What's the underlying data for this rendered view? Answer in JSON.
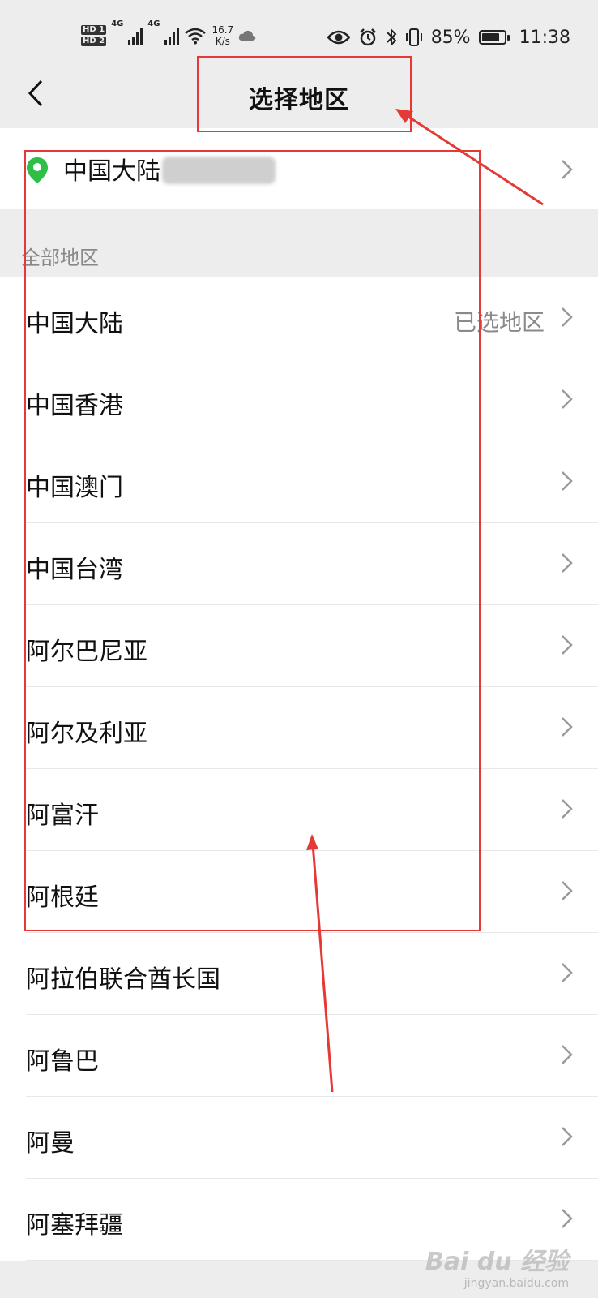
{
  "status_bar": {
    "hd1": "HD 1",
    "hd2": "HD 2",
    "net1": "4G",
    "net2": "4G",
    "speed_value": "16.7",
    "speed_unit": "K/s",
    "battery_percent": "85%",
    "battery_level": 0.85,
    "time": "11:38"
  },
  "nav": {
    "title": "选择地区"
  },
  "current_location": {
    "name": "中国大陆"
  },
  "section_header": "全部地区",
  "regions": [
    {
      "name": "中国大陆",
      "note": "已选地区"
    },
    {
      "name": "中国香港",
      "note": ""
    },
    {
      "name": "中国澳门",
      "note": ""
    },
    {
      "name": "中国台湾",
      "note": ""
    },
    {
      "name": "阿尔巴尼亚",
      "note": ""
    },
    {
      "name": "阿尔及利亚",
      "note": ""
    },
    {
      "name": "阿富汗",
      "note": ""
    },
    {
      "name": "阿根廷",
      "note": ""
    },
    {
      "name": "阿拉伯联合酋长国",
      "note": ""
    },
    {
      "name": "阿鲁巴",
      "note": ""
    },
    {
      "name": "阿曼",
      "note": ""
    },
    {
      "name": "阿塞拜疆",
      "note": ""
    }
  ],
  "watermark": {
    "brand": "Bai du 经验",
    "site": "jingyan.baidu.com"
  },
  "colors": {
    "accent_pin": "#2fbf47",
    "annotation": "#e53935"
  }
}
